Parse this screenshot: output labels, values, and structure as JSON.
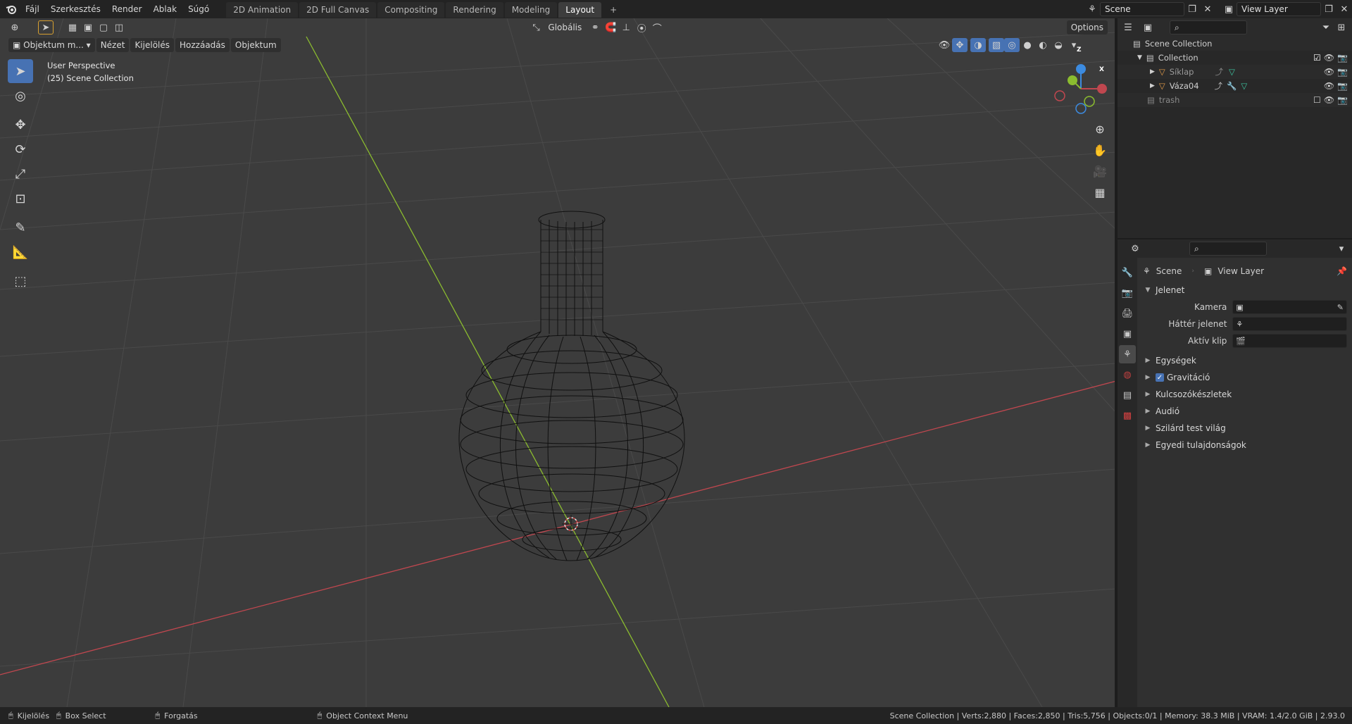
{
  "topbar": {
    "menus": [
      "Fájl",
      "Szerkesztés",
      "Render",
      "Ablak",
      "Súgó"
    ],
    "workspaces": [
      "2D Animation",
      "2D Full Canvas",
      "Compositing",
      "Rendering",
      "Modeling",
      "Layout"
    ],
    "active_workspace": "Layout",
    "add_tab": "+",
    "scene_name": "Scene",
    "view_layer_name": "View Layer"
  },
  "viewport_header": {
    "mode": "Objektum m...",
    "menus": [
      "Nézet",
      "Kijelölés",
      "Hozzáadás",
      "Objektum"
    ],
    "orientation": "Globális",
    "options_label": "Options"
  },
  "viewport": {
    "perspective": "User Perspective",
    "collection_info": "(25) Scene Collection",
    "gizmo_axes": [
      "Z",
      "X"
    ]
  },
  "toolbar": {
    "tools": [
      "select-box",
      "cursor",
      "move",
      "rotate",
      "scale",
      "transform",
      "annotate",
      "measure",
      "add-cube"
    ]
  },
  "outliner": {
    "search_placeholder": "",
    "rows": [
      {
        "label": "Scene Collection",
        "indent": 0
      },
      {
        "label": "Collection",
        "indent": 1
      },
      {
        "label": "Síklap",
        "indent": 2
      },
      {
        "label": "Váza04",
        "indent": 2
      },
      {
        "label": "trash",
        "indent": 1
      }
    ]
  },
  "properties": {
    "breadcrumb_scene": "Scene",
    "breadcrumb_layer": "View Layer",
    "panel_title": "Jelenet",
    "fields": [
      {
        "label": "Kamera",
        "value": ""
      },
      {
        "label": "Háttér jelenet",
        "value": ""
      },
      {
        "label": "Aktív klip",
        "value": ""
      }
    ],
    "sections": [
      "Egységek",
      "Gravitáció",
      "Kulcsozókészletek",
      "Audió",
      "Szilárd test világ",
      "Egyedi tulajdonságok"
    ],
    "gravity_checked": true
  },
  "statusbar": {
    "left_select": "Kijelölés",
    "box_select": "Box Select",
    "rotate": "Forgatás",
    "context_menu": "Object Context Menu",
    "stats": "Scene Collection | Verts:2,880 | Faces:2,850 | Tris:5,756 | Objects:0/1 | Memory: 38.3 MiB | VRAM: 1.4/2.0 GiB | 2.93.0"
  },
  "colors": {
    "accent": "#4772b3",
    "x_axis": "#c0474f",
    "y_axis": "#8bbc2f",
    "z_axis": "#3c8be0",
    "viewport_bg": "#3c3c3c"
  }
}
